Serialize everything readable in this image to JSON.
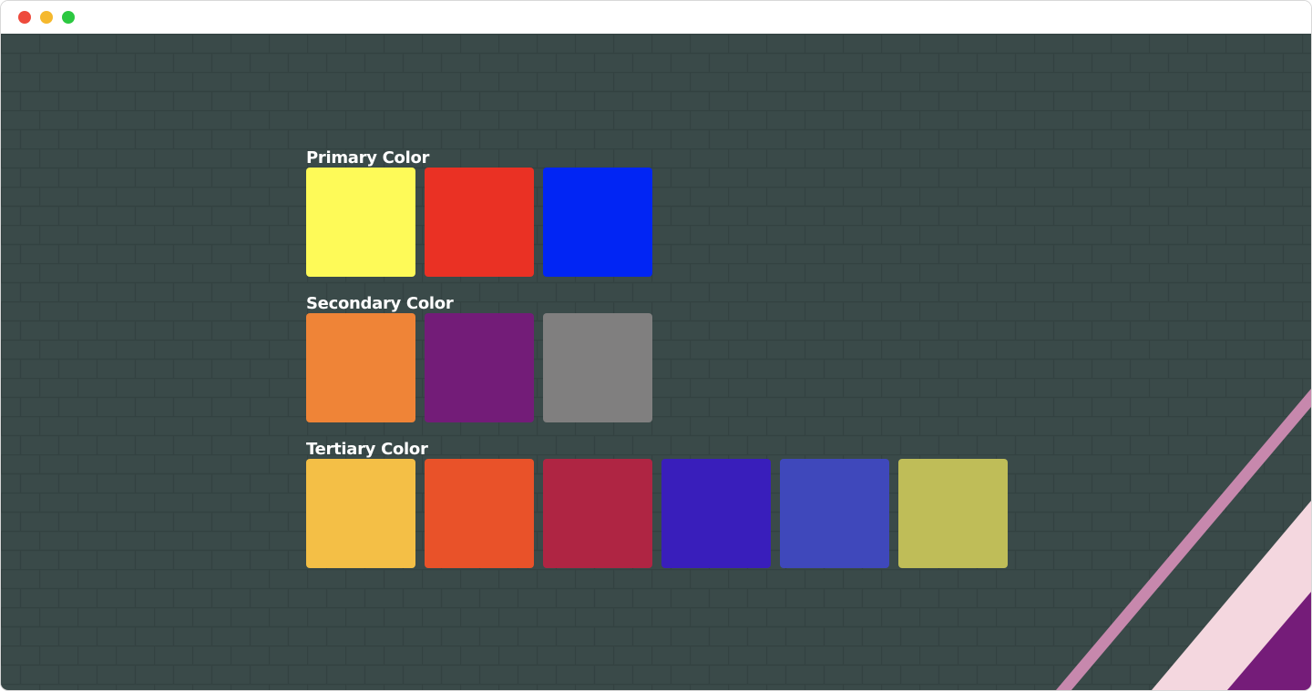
{
  "window": {
    "controls": [
      {
        "name": "close",
        "color": "#ee4a3c"
      },
      {
        "name": "minimize",
        "color": "#f5b82d"
      },
      {
        "name": "maximize",
        "color": "#2bc840"
      }
    ]
  },
  "background": {
    "base_color": "#3a4a49",
    "brick_line_color": "#334241",
    "stripe_colors": [
      "#c788ad",
      "#f4d7df",
      "#751c79"
    ]
  },
  "palette": {
    "groups": [
      {
        "title": "Primary Color",
        "swatches": [
          "#fefa58",
          "#ea3124",
          "#0125f4"
        ]
      },
      {
        "title": "Secondary Color",
        "swatches": [
          "#ef8437",
          "#731c78",
          "#807f7f"
        ]
      },
      {
        "title": "Tertiary Color",
        "swatches": [
          "#f4bf46",
          "#e95229",
          "#af2543",
          "#391ebb",
          "#3f48bb",
          "#bfbd58"
        ]
      }
    ]
  }
}
